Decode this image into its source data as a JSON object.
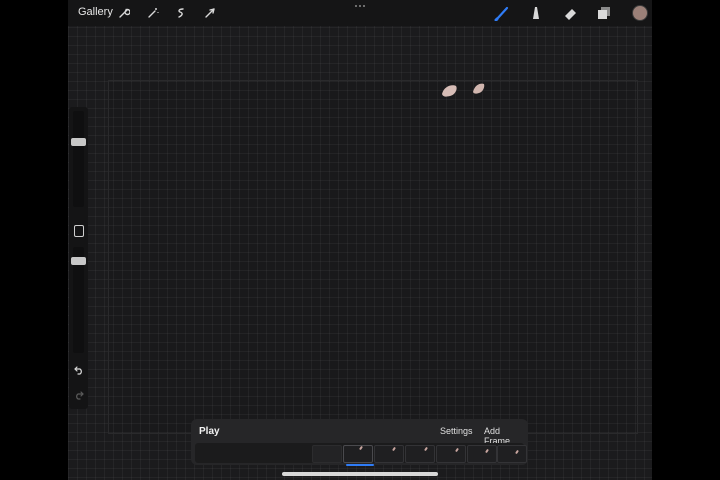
{
  "toolbar": {
    "gallery_label": "Gallery",
    "tools_left": [
      "wrench-icon",
      "magic-wand-icon",
      "selection-icon",
      "transform-arrow-icon"
    ],
    "tools_right": [
      "brush-icon",
      "smudge-icon",
      "eraser-icon",
      "layers-icon"
    ],
    "active_tool": "brush-icon",
    "current_color": "#9b8078",
    "accent_color": "#2f7cf6"
  },
  "sidebar": {
    "controls": [
      "brush-size-slider",
      "modify-button",
      "opacity-slider",
      "undo-icon",
      "redo-icon"
    ]
  },
  "animation_assist": {
    "play_label": "Play",
    "settings_label": "Settings",
    "add_frame_label": "Add Frame",
    "frame_count": 7,
    "selected_frame": 2
  }
}
